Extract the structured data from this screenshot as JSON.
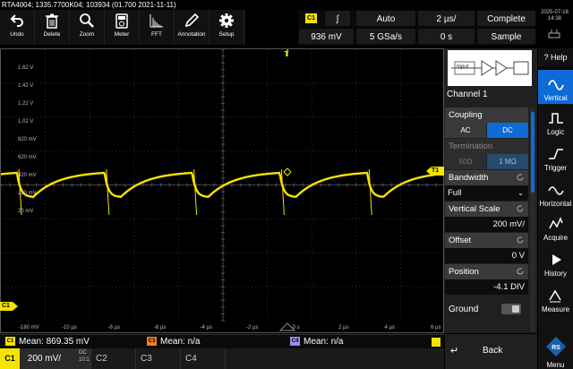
{
  "title": "RTA4004; 1335.7700K04; 103934 (01.700 2021-11-11)",
  "toolbar": [
    {
      "label": "Undo",
      "icon": "undo-icon"
    },
    {
      "label": "Delete",
      "icon": "trash-icon"
    },
    {
      "label": "Zoom",
      "icon": "zoom-icon"
    },
    {
      "label": "Meter",
      "icon": "meter-icon"
    },
    {
      "label": "FFT",
      "icon": "fft-icon"
    },
    {
      "label": "Annotation",
      "icon": "pen-icon"
    },
    {
      "label": "Setup",
      "icon": "gear-icon"
    }
  ],
  "acquisition": {
    "channel_tag": "C1",
    "trigger_slope": "∫",
    "trigger_mode": "Auto",
    "time_scale": "2 µs/",
    "acq_status": "Complete",
    "trigger_level": "936 mV",
    "sample_rate": "5 GSa/s",
    "time_offset": "0 s",
    "acq_mode": "Sample"
  },
  "clock": {
    "date": "2025-07-18",
    "time": "14:38"
  },
  "graph": {
    "y_labels": [
      "1.62 V",
      "1.42 V",
      "1.22 V",
      "1.02 V",
      "820 mV",
      "620 mV",
      "420 mV",
      "220 mV",
      "20 mV"
    ],
    "x_labels": [
      "-10 µs",
      "-8 µs",
      "-6 µs",
      "-4 µs",
      "-2 µs",
      "0 s",
      "2 µs",
      "4 µs",
      "6 µs",
      "8 µs"
    ],
    "x_first_label": "-180 mV",
    "trigger_marker": "T",
    "t1_label": "T1",
    "c1_label": "C1",
    "trace_color": "#f5e400"
  },
  "measurements": [
    {
      "tag": "C1",
      "tag_color": "#f5e400",
      "text": "Mean: 869.35 mV"
    },
    {
      "tag": "C3",
      "tag_color": "#f0801e",
      "text": "Mean: n/a"
    },
    {
      "tag": "C4",
      "tag_color": "#9b8ce8",
      "text": "Mean: n/a"
    }
  ],
  "channels": {
    "c1_tag": "C1",
    "c1_scale": "200 mV/",
    "c1_coupling": "DC",
    "c1_probe": "10:1",
    "c2": "C2",
    "c3": "C3",
    "c4": "C4"
  },
  "panel": {
    "help": "? Help",
    "diagram_input": "Input",
    "title": "Channel 1",
    "coupling_label": "Coupling",
    "coupling_ac": "AC",
    "coupling_dc": "DC",
    "termination_label": "Termination",
    "term_50": "50Ω",
    "term_1m": "1 MΩ",
    "bandwidth_label": "Bandwidth",
    "bandwidth_value": "Full",
    "vscale_label": "Vertical Scale",
    "vscale_value": "200 mV/",
    "offset_label": "Offset",
    "offset_value": "0 V",
    "position_label": "Position",
    "position_value": "-4.1 DIV",
    "ground_label": "Ground",
    "back": "Back"
  },
  "sidenav": [
    {
      "label": "Vertical",
      "icon": "vertical-wave-icon",
      "active": true
    },
    {
      "label": "Logic",
      "icon": "logic-icon",
      "active": false
    },
    {
      "label": "Trigger",
      "icon": "trigger-icon",
      "active": false
    },
    {
      "label": "Horizontal",
      "icon": "horizontal-icon",
      "active": false
    },
    {
      "label": "Acquire",
      "icon": "acquire-icon",
      "active": false
    },
    {
      "label": "History",
      "icon": "play-icon",
      "active": false
    },
    {
      "label": "Measure",
      "icon": "measure-icon",
      "active": false
    }
  ],
  "menu": "Menu"
}
